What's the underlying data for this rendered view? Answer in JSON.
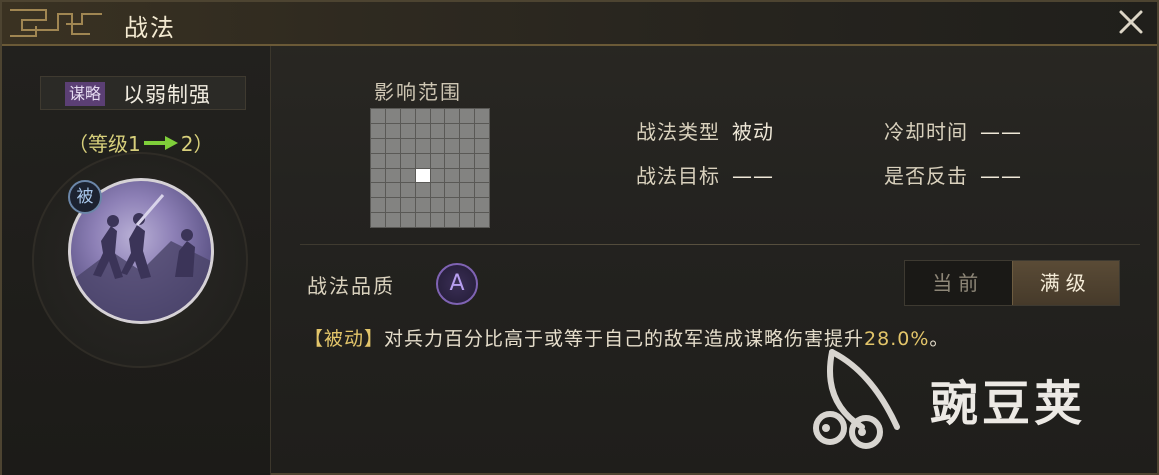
{
  "window": {
    "title": "战法",
    "close_icon": "close-icon"
  },
  "skill": {
    "type_tag": "谋略",
    "name": "以弱制强",
    "level_prefix": "（等级1",
    "level_suffix": "2）",
    "passive_badge": "被",
    "emblem_icon": "warriors-emblem-icon"
  },
  "range": {
    "title": "影响范围",
    "grid_size": 8,
    "active_cell": [
      4,
      3
    ]
  },
  "info": {
    "type_label": "战法类型",
    "type_value": "被动",
    "cooldown_label": "冷却时间",
    "cooldown_value": "——",
    "target_label": "战法目标",
    "target_value": "——",
    "counter_label": "是否反击",
    "counter_value": "——"
  },
  "quality": {
    "label": "战法品质",
    "grade": "A"
  },
  "toggle": {
    "current": "当前",
    "max": "满级",
    "selected": "max"
  },
  "description": {
    "tag": "【被动】",
    "text": "对兵力百分比高于或等于自己的敌军造成谋略伤害提升",
    "value": "28.0%",
    "end": "。"
  },
  "watermark": {
    "text": "豌豆荚"
  },
  "colors": {
    "accent_gold": "#e3c56a",
    "level_green": "#7fcf3a",
    "tag_purple": "#5b3f74",
    "quality_purple": "#7f63b3"
  }
}
